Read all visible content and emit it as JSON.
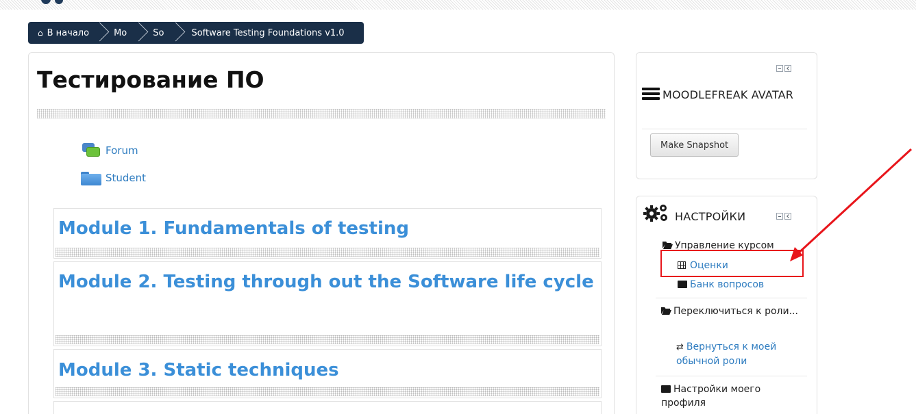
{
  "breadcrumb": {
    "items": [
      "В начало",
      "Mo",
      "So",
      "Software Testing Foundations v1.0"
    ]
  },
  "main": {
    "title": "Тестирование ПО",
    "activities": [
      {
        "label": "Forum",
        "icon": "forum-icon"
      },
      {
        "label": "Student",
        "icon": "folder-icon"
      }
    ],
    "modules": [
      "Module 1. Fundamentals of testing",
      "Module 2. Testing through out the Software life cycle",
      "Module 3. Static techniques"
    ]
  },
  "avatar_block": {
    "title": "MOODLEFREAK AVATAR",
    "button": "Make Snapshot"
  },
  "settings_block": {
    "title": "НАСТРОЙКИ",
    "course_admin": "Управление курсом",
    "grades": "Оценки",
    "question_bank": "Банк вопросов",
    "switch_role": "Переключиться к роли...",
    "return_role": "Вернуться к моей обычной роли",
    "profile_settings": "Настройки моего профиля"
  },
  "colors": {
    "breadcrumb_bg": "#1a2f48",
    "link": "#2e7cc0",
    "module_title": "#3b8fd8",
    "annotation": "#e8151b"
  }
}
